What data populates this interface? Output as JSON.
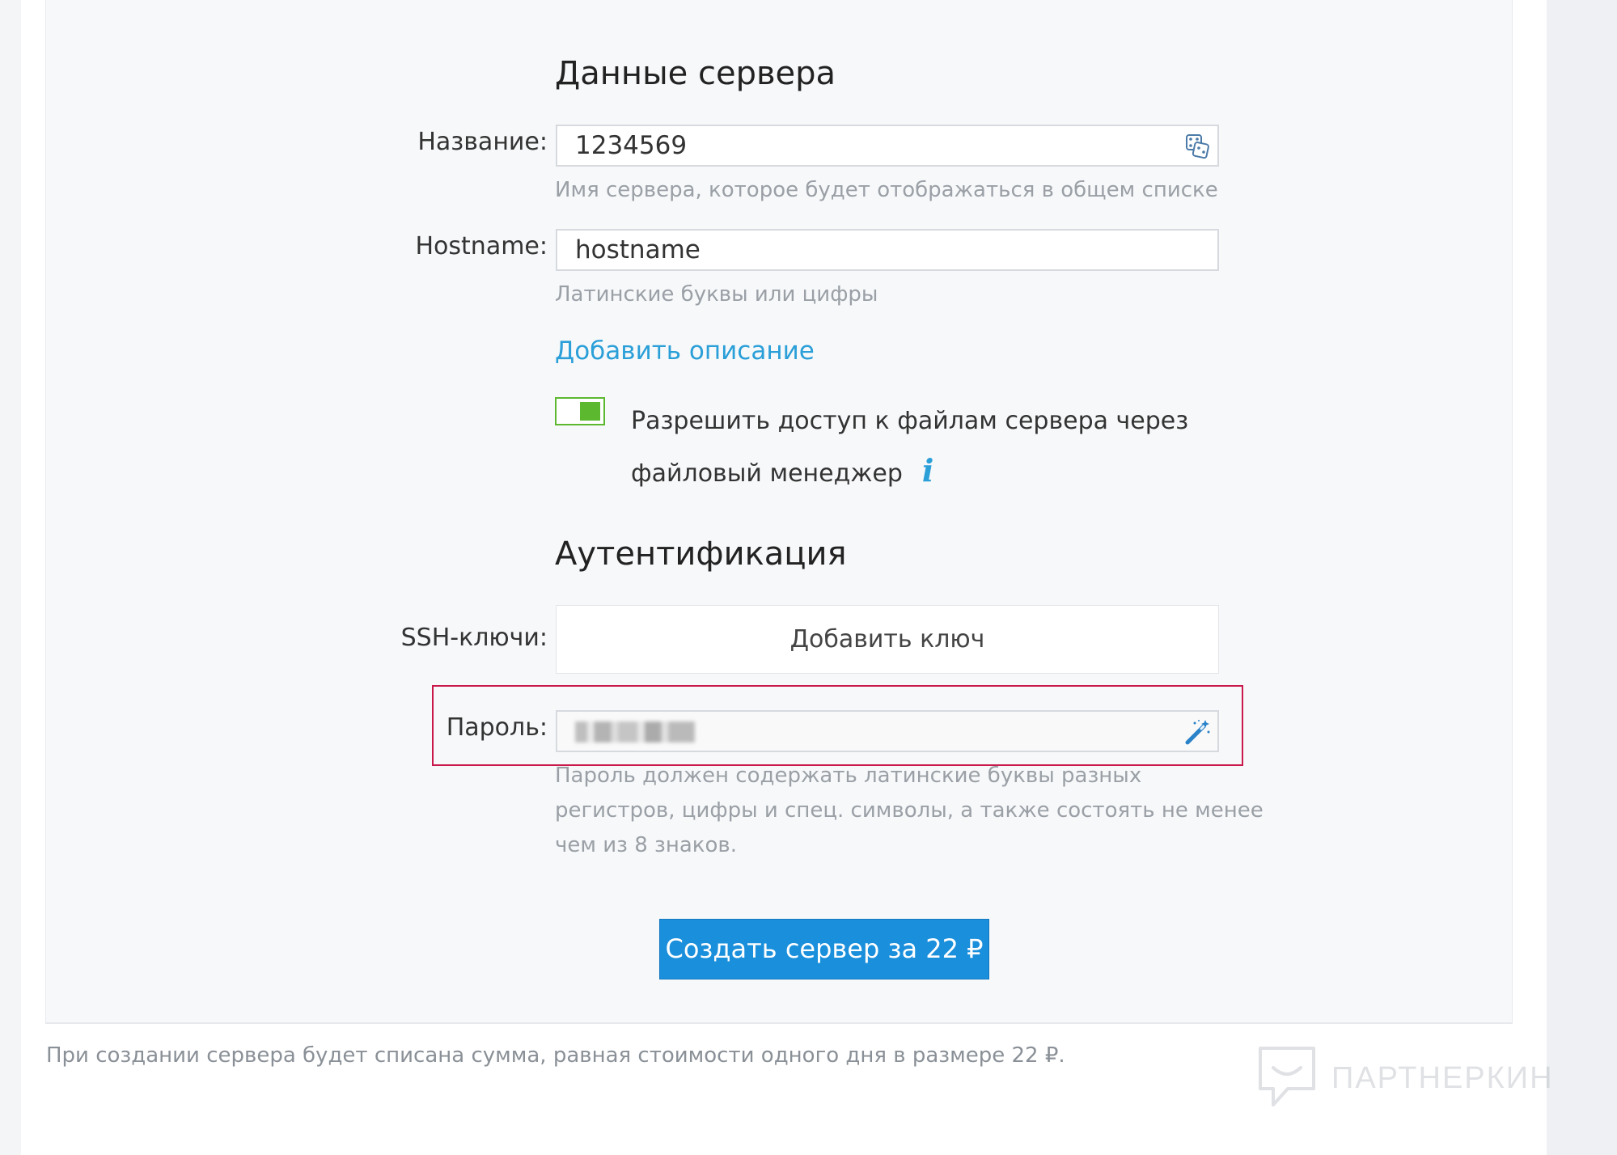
{
  "server_data": {
    "title": "Данные сервера",
    "name_label": "Название:",
    "name_value": "1234569",
    "name_hint": "Имя сервера, которое будет отображаться в общем списке",
    "hostname_label": "Hostname:",
    "hostname_value": "hostname",
    "hostname_hint": "Латинские буквы или цифры",
    "add_description_link": "Добавить описание",
    "file_access_toggle": {
      "label_line1": "Разрешить доступ к файлам сервера через",
      "label_line2": "файловый менеджер",
      "checked": true,
      "info_icon": "i"
    }
  },
  "auth": {
    "title": "Аутентификация",
    "ssh_label": "SSH-ключи:",
    "add_key_button": "Добавить ключ",
    "password_label": "Пароль:",
    "password_hint_lines": [
      "Пароль должен содержать латинские буквы разных",
      "регистров, цифры и спец. символы, а также состоять не менее",
      "чем из 8 знаков."
    ]
  },
  "create_button": "Создать сервер за 22 ₽",
  "footer_note": "При создании сервера будет списана сумма, равная стоимости одного дня в размере 22 ₽.",
  "watermark": "ПАРТНЕРКИН",
  "colors": {
    "accent_blue": "#1a8fdb",
    "link_blue": "#2a9fd8",
    "toggle_green": "#5cb82e",
    "highlight_red": "#c9184a"
  },
  "icons": {
    "name_generate": "dice-icon",
    "password_generate": "magic-wand-icon",
    "info": "info-icon",
    "watermark_logo": "chat-bubble-logo-icon"
  }
}
